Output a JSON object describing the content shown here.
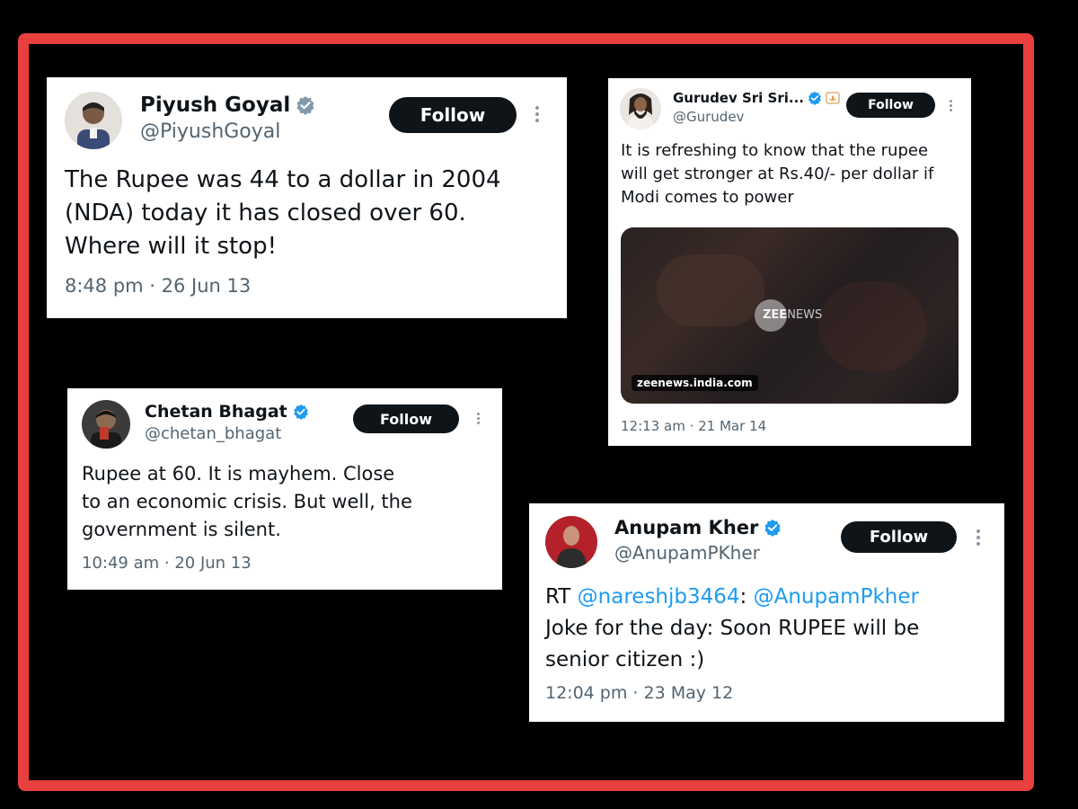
{
  "tweets": {
    "piyush": {
      "name": "Piyush Goyal",
      "handle": "@PiyushGoyal",
      "follow_label": "Follow",
      "text_lines": [
        "The Rupee was 44 to a dollar in 2004",
        "(NDA) today it has closed over 60.",
        "Where will it stop!"
      ],
      "timestamp": "8:48 pm · 26 Jun 13"
    },
    "gurudev": {
      "name": "Gurudev Sri Sri...",
      "handle": "@Gurudev",
      "follow_label": "Follow",
      "text_lines": [
        "It is refreshing to know that the rupee",
        "will get stronger at Rs.40/- per dollar if",
        "Modi comes to power"
      ],
      "media_brand_zee": "ZEE",
      "media_brand_news": "NEWS",
      "media_source": "zeenews.india.com",
      "timestamp": "12:13 am · 21 Mar 14"
    },
    "chetan": {
      "name": "Chetan Bhagat",
      "handle": "@chetan_bhagat",
      "follow_label": "Follow",
      "text_lines": [
        "Rupee at 60. It is mayhem. Close",
        "to an economic crisis. But well, the",
        "government is silent."
      ],
      "timestamp": "10:49 am · 20 Jun 13"
    },
    "anupam": {
      "name": "Anupam Kher",
      "handle": "@AnupamPKher",
      "follow_label": "Follow",
      "rt_prefix": "RT ",
      "mention_1": "@nareshjb3464",
      "colon": ": ",
      "mention_2": "@AnupamPkher",
      "text_line_2": "Joke for the day: Soon RUPEE will be",
      "text_line_3": "senior citizen :)",
      "timestamp": "12:04 pm · 23 May 12"
    }
  },
  "colors": {
    "frame": "#e8403f",
    "verified": "#1d9bf0",
    "mention": "#1d9bf0",
    "follow_bg": "#0f1419"
  },
  "icons": {
    "verified": "verified-badge-icon",
    "more": "more-options-icon",
    "emoji": "lotus-emoji-icon"
  }
}
